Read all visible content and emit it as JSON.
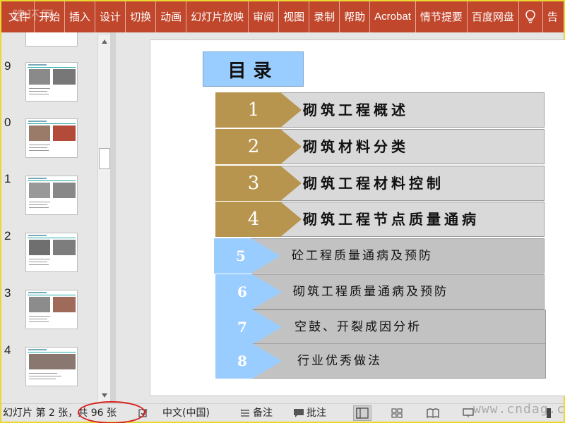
{
  "ribbon": {
    "tabs": [
      "文件",
      "开始",
      "插入",
      "设计",
      "切换",
      "动画",
      "幻灯片放映",
      "审阅",
      "视图",
      "录制",
      "帮助",
      "Acrobat",
      "情节提要",
      "百度网盘"
    ],
    "tell_me_cut": "告",
    "tab_color": "#c1472c",
    "watermark": "建环网"
  },
  "thumbnails": {
    "numbers": [
      "9",
      "0",
      "1",
      "2",
      "3",
      "4"
    ],
    "icon_up": "triangle-up",
    "icon_down": "triangle-down"
  },
  "slide": {
    "title": "目录",
    "title_color": "#99ccff",
    "items": [
      {
        "num": "1",
        "label": "砌筑工程概述",
        "badge_color": "#b8954e"
      },
      {
        "num": "2",
        "label": "砌筑材料分类",
        "badge_color": "#b8954e"
      },
      {
        "num": "3",
        "label": "砌筑工程材料控制",
        "badge_color": "#b8954e"
      },
      {
        "num": "4",
        "label": "砌筑工程节点质量通病",
        "badge_color": "#b8954e"
      },
      {
        "num": "5",
        "label": "砼工程质量通病及预防",
        "badge_color": "#99ccff"
      },
      {
        "num": "6",
        "label": "砌筑工程质量通病及预防",
        "badge_color": "#99ccff"
      },
      {
        "num": "7",
        "label": "空鼓、开裂成因分析",
        "badge_color": "#99ccff"
      },
      {
        "num": "8",
        "label": "行业优秀做法",
        "badge_color": "#99ccff"
      }
    ]
  },
  "status": {
    "slide_info": "幻灯片 第 2 张，共 96 张",
    "language": "中文(中国)",
    "notes": "备注",
    "comments": "批注",
    "watermark": "www.cndag.com",
    "highlight_color": "#d81e1e"
  }
}
